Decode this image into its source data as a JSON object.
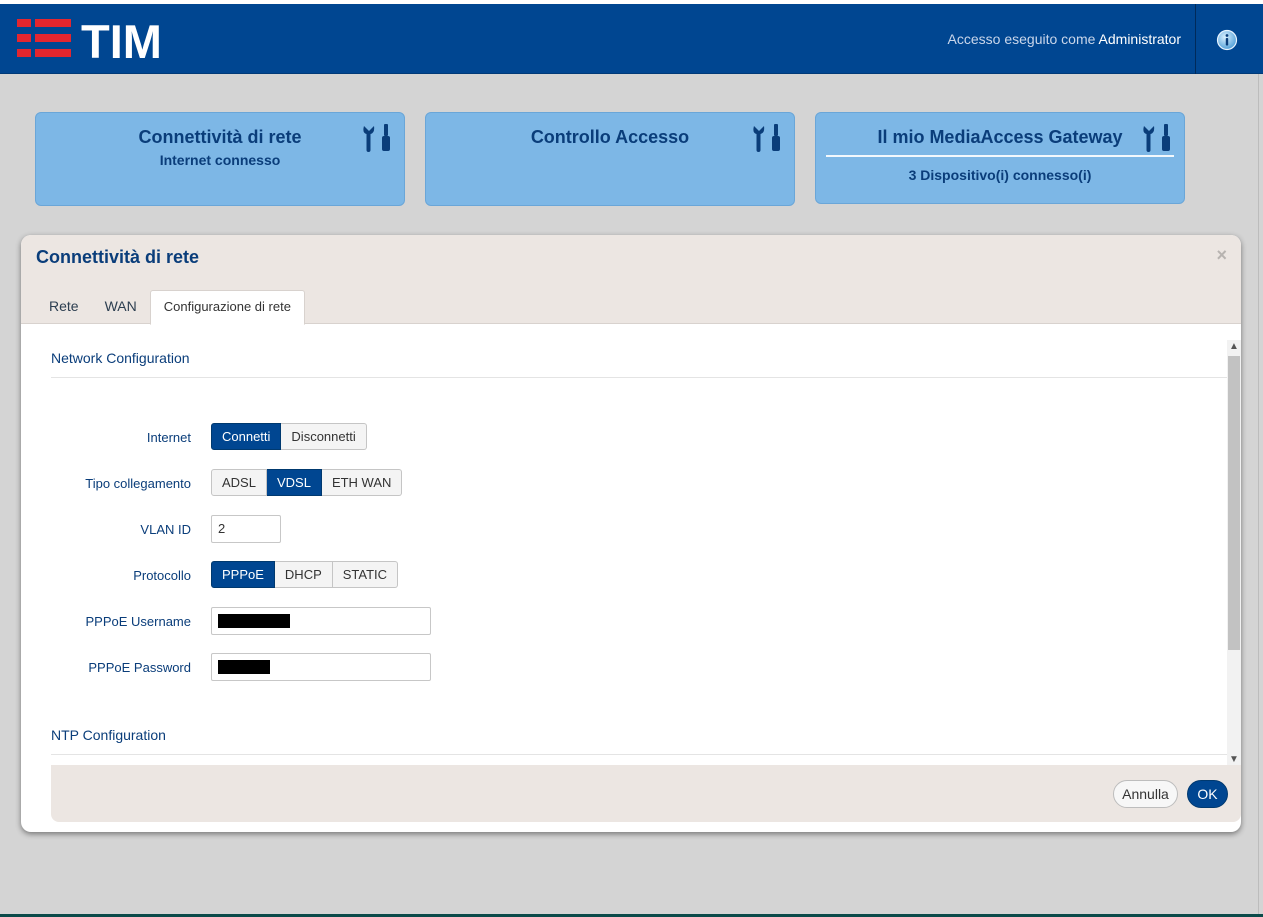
{
  "header": {
    "logo_text": "TIM",
    "login_prefix": "Accesso eseguito come",
    "login_user": "Administrator",
    "info_icon": "info-icon",
    "colors": {
      "brand": "#004691",
      "logo_red": "#e3262f"
    }
  },
  "cards": [
    {
      "title": "Connettività di rete",
      "subtitle": "Internet connesso",
      "icon": "tools-icon"
    },
    {
      "title": "Controllo Accesso",
      "subtitle": "",
      "icon": "tools-icon"
    },
    {
      "title": "Il mio MediaAccess Gateway",
      "subtitle": "3 Dispositivo(i) connesso(i)",
      "icon": "tools-icon"
    }
  ],
  "modal": {
    "title": "Connettività di rete",
    "close_label": "×",
    "tabs": [
      {
        "label": "Rete",
        "active": false
      },
      {
        "label": "WAN",
        "active": false
      },
      {
        "label": "Configurazione di rete",
        "active": true
      }
    ],
    "section_network": "Network Configuration",
    "section_ntp": "NTP Configuration",
    "fields": {
      "internet": {
        "label": "Internet",
        "options": [
          "Connetti",
          "Disconnetti"
        ],
        "selected": "Connetti"
      },
      "link_type": {
        "label": "Tipo collegamento",
        "options": [
          "ADSL",
          "VDSL",
          "ETH WAN"
        ],
        "selected": "VDSL"
      },
      "vlan": {
        "label": "VLAN ID",
        "value": "2"
      },
      "protocol": {
        "label": "Protocollo",
        "options": [
          "PPPoE",
          "DHCP",
          "STATIC"
        ],
        "selected": "PPPoE"
      },
      "pppoe_user": {
        "label": "PPPoE Username",
        "value": ""
      },
      "pppoe_pass": {
        "label": "PPPoE Password",
        "value": ""
      }
    },
    "footer": {
      "cancel_label": "Annulla",
      "ok_label": "OK"
    }
  }
}
